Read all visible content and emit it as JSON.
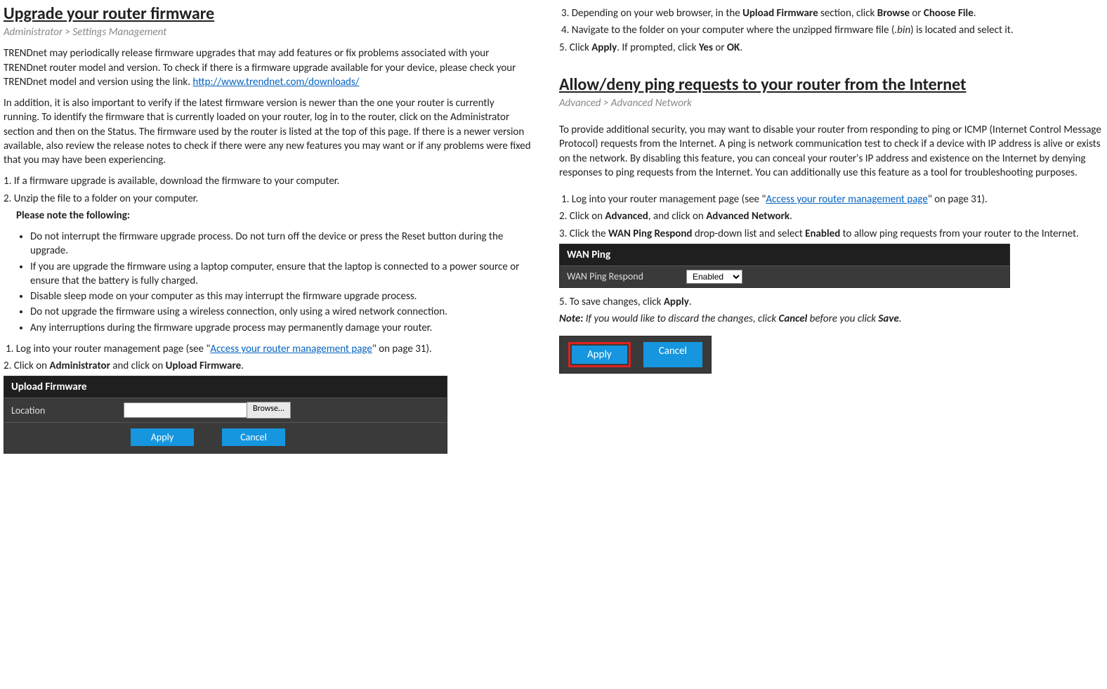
{
  "left": {
    "title": "Upgrade your router firmware",
    "breadcrumb": "Administrator > Settings Management",
    "para1_pre": "TRENDnet may periodically release firmware upgrades that may add features or fix problems associated with your TRENDnet router model and version. To check if there is a firmware upgrade available for your device, please check your TRENDnet model and version using the link. ",
    "link1": "http://www.trendnet.com/downloads/",
    "para2": "In addition, it is also important to verify if the latest firmware version is newer than the one your router is currently running. To identify the firmware that is currently loaded on your router, log in to the router, click on the Administrator section and then on the Status. The firmware used by the router is listed at the top of this page. If there is a newer version available, also review the release notes to check if there were any new features you may want or if any problems were fixed that you may have been experiencing.",
    "step1": "1. If a firmware upgrade is available, download the firmware to your computer.",
    "step2": "2. Unzip the file to a folder on your computer.",
    "note_head": "Please note the following:",
    "bullets": [
      "Do not interrupt the firmware upgrade process. Do not turn off the device or press the Reset button during the upgrade.",
      "If you are upgrade the firmware using a laptop computer, ensure that the laptop is connected to a power source or ensure that the battery is fully charged.",
      "Disable sleep mode on your computer as this may interrupt the firmware upgrade process.",
      "Do not upgrade the firmware using a wireless connection, only using a wired network connection.",
      "Any interruptions during the firmware upgrade process may permanently damage your router."
    ],
    "step1b_pre": "1. Log into your router management page (see \"",
    "step1b_link": "Access your router management page",
    "step1b_post": "\" on page 31).",
    "step2b_pre": "2. Click on ",
    "step2b_b1": "Administrator",
    "step2b_mid": " and click on ",
    "step2b_b2": "Upload Firmware",
    "upload": {
      "title": "Upload Firmware",
      "label": "Location",
      "browse": "Browse...",
      "apply": "Apply",
      "cancel": "Cancel"
    }
  },
  "right": {
    "step3_pre": "3. Depending on your web browser, in the ",
    "step3_b": "Upload Firmware",
    "step3_mid": " section, click ",
    "step3_b2": "Browse",
    "step3_or": " or ",
    "step3_b3": "Choose File",
    "step4_pre": "4. Navigate to the folder on your computer where the unzipped firmware file (",
    "step4_i": ".bin",
    "step4_post": ") is located and select it.",
    "step5_pre": "5. Click ",
    "step5_b1": "Apply",
    "step5_mid": ". If prompted, click ",
    "step5_b2": "Yes",
    "step5_or": " or ",
    "step5_b3": "OK",
    "title2": "Allow/deny ping requests to your router from the Internet",
    "breadcrumb2": "Advanced > Advanced Network",
    "para": "To provide additional security, you may want to disable your router from responding to ping or ICMP (Internet Control Message Protocol) requests from the Internet. A ping is network communication test to check if a device with IP address is alive or exists on the network. By disabling this feature, you can conceal your router's IP address and existence on the Internet by denying responses to ping requests from the Internet. You can additionally use this feature as a tool for troubleshooting purposes.",
    "r_step1_pre": "1. Log into your router management page (see \"",
    "r_step1_link": "Access your router management page",
    "r_step1_post": "\" on page 31).",
    "r_step2_pre": "2. Click on ",
    "r_step2_b1": "Advanced",
    "r_step2_mid": ", and click on ",
    "r_step2_b2": "Advanced Network",
    "r_step3_pre": "3. Click the ",
    "r_step3_b1": "WAN Ping Respond",
    "r_step3_mid": " drop-down list and select ",
    "r_step3_b2": "Enabled",
    "r_step3_post": " to allow ping requests from your router to the Internet.",
    "wanping": {
      "title": "WAN Ping",
      "label": "WAN Ping Respond",
      "value": "Enabled"
    },
    "r_step5_pre": "5. To save changes, click ",
    "r_step5_b": "Apply",
    "note_pre": "Note:",
    "note_i_pre": " If you would like to discard the changes, click ",
    "note_b1": "Cancel",
    "note_i_mid": " before you click ",
    "note_b2": "Save",
    "ac": {
      "apply": "Apply",
      "cancel": "Cancel"
    }
  }
}
